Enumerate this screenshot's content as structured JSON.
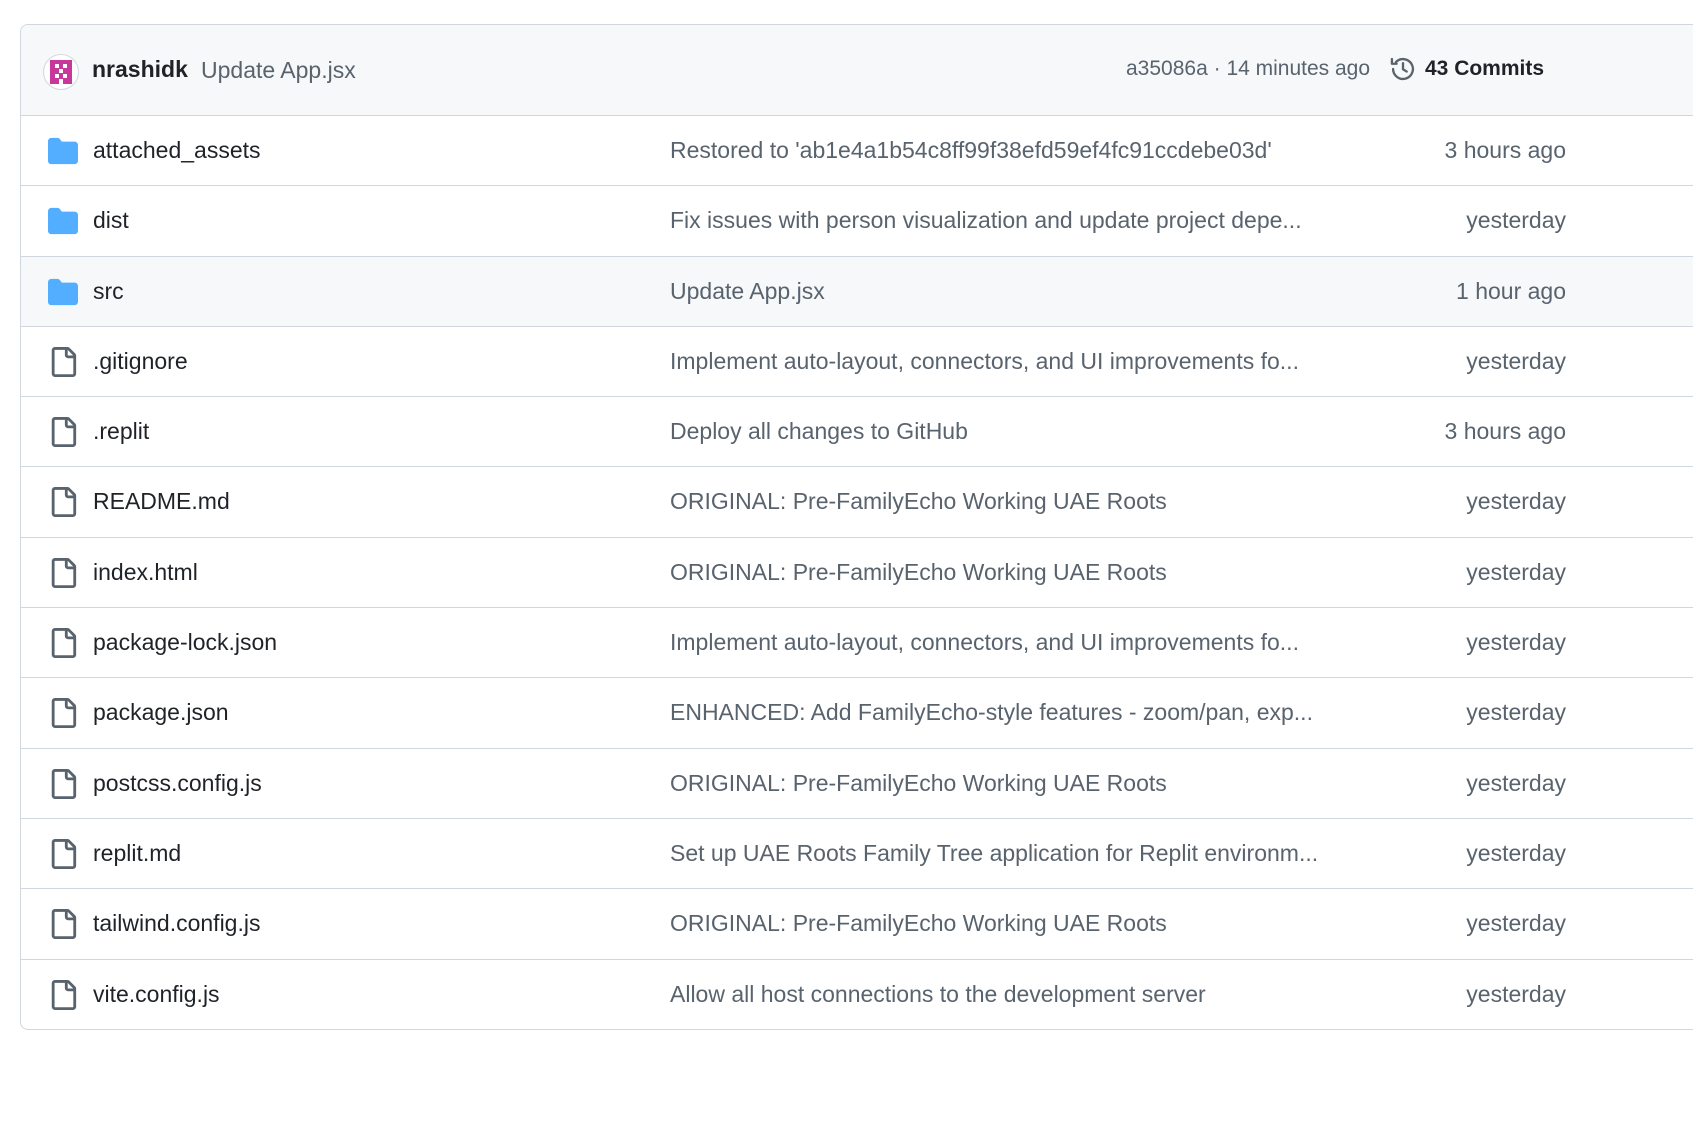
{
  "header": {
    "author": "nrashidk",
    "commit_message": "Update App.jsx",
    "sha": "a35086a",
    "separator": " · ",
    "time": "14 minutes ago",
    "commits_label": "43 Commits"
  },
  "files": [
    {
      "type": "folder",
      "name": "attached_assets",
      "message": "Restored to 'ab1e4a1b54c8ff99f38efd59ef4fc91ccdebe03d'",
      "time": "3 hours ago"
    },
    {
      "type": "folder",
      "name": "dist",
      "message": "Fix issues with person visualization and update project depe...",
      "time": "yesterday"
    },
    {
      "type": "folder",
      "name": "src",
      "message": "Update App.jsx",
      "time": "1 hour ago"
    },
    {
      "type": "file",
      "name": ".gitignore",
      "message": "Implement auto-layout, connectors, and UI improvements fo...",
      "time": "yesterday"
    },
    {
      "type": "file",
      "name": ".replit",
      "message": "Deploy all changes to GitHub",
      "time": "3 hours ago"
    },
    {
      "type": "file",
      "name": "README.md",
      "message": "ORIGINAL: Pre-FamilyEcho Working UAE Roots",
      "time": "yesterday"
    },
    {
      "type": "file",
      "name": "index.html",
      "message": "ORIGINAL: Pre-FamilyEcho Working UAE Roots",
      "time": "yesterday"
    },
    {
      "type": "file",
      "name": "package-lock.json",
      "message": "Implement auto-layout, connectors, and UI improvements fo...",
      "time": "yesterday"
    },
    {
      "type": "file",
      "name": "package.json",
      "message": "ENHANCED: Add FamilyEcho-style features - zoom/pan, exp...",
      "time": "yesterday"
    },
    {
      "type": "file",
      "name": "postcss.config.js",
      "message": "ORIGINAL: Pre-FamilyEcho Working UAE Roots",
      "time": "yesterday"
    },
    {
      "type": "file",
      "name": "replit.md",
      "message": "Set up UAE Roots Family Tree application for Replit environm...",
      "time": "yesterday"
    },
    {
      "type": "file",
      "name": "tailwind.config.js",
      "message": "ORIGINAL: Pre-FamilyEcho Working UAE Roots",
      "time": "yesterday"
    },
    {
      "type": "file",
      "name": "vite.config.js",
      "message": "Allow all host connections to the development server",
      "time": "yesterday"
    }
  ],
  "icons": {
    "folder": "folder-icon",
    "file": "file-icon",
    "history": "history-icon"
  },
  "colors": {
    "folder": "#54aeff",
    "file_outline": "#59636e",
    "avatar": "#c8389b"
  }
}
